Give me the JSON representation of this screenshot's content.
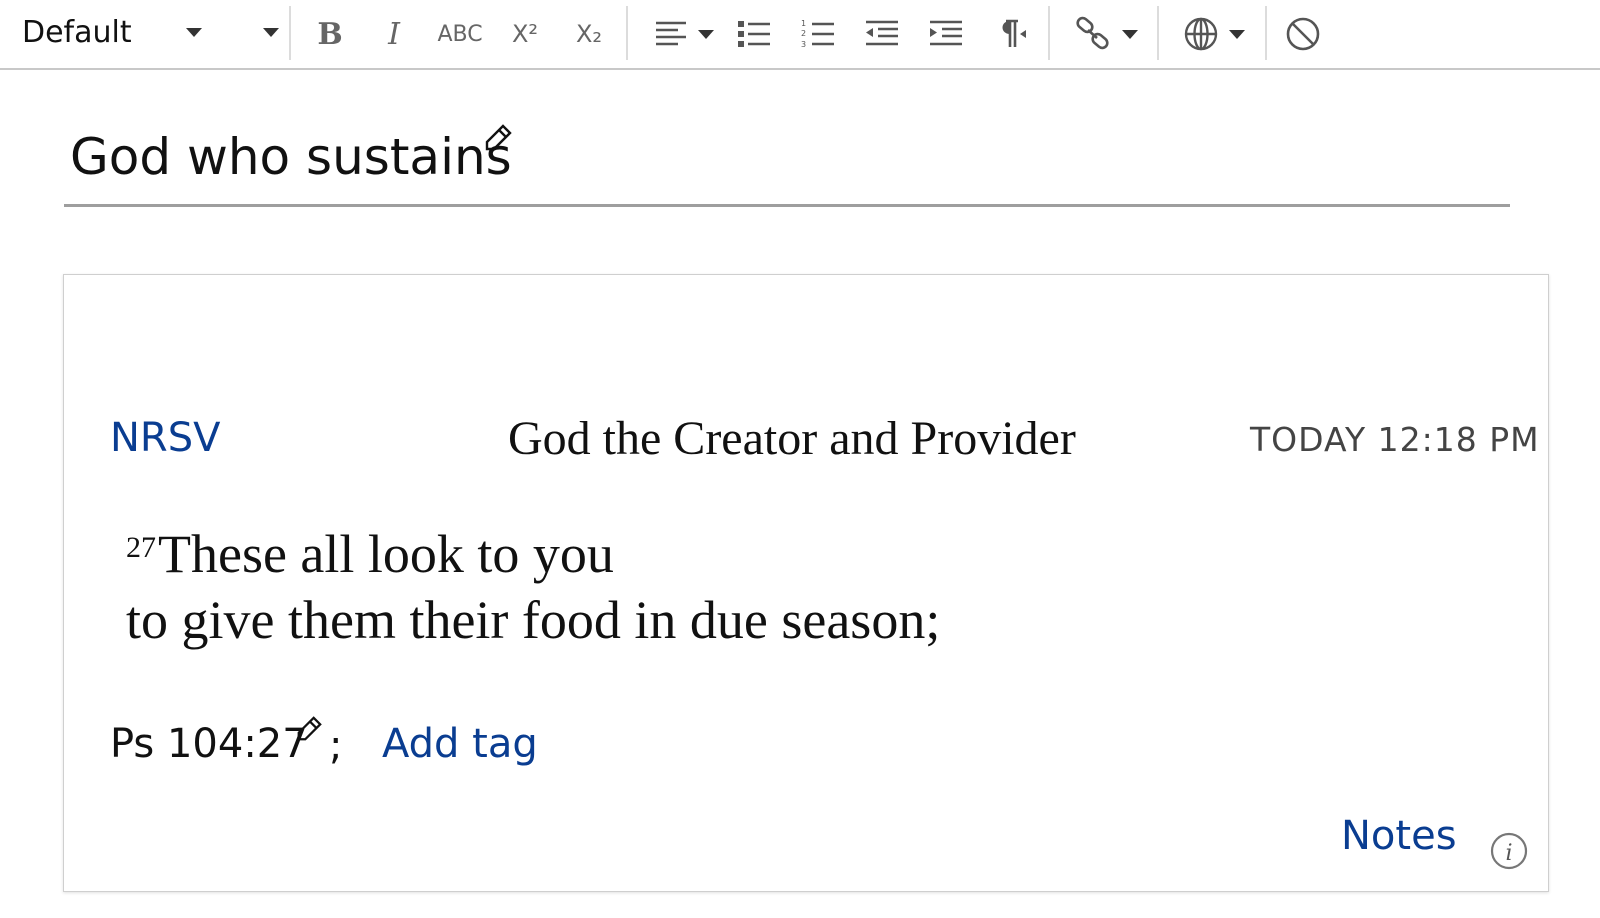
{
  "toolbar": {
    "style_select": {
      "value": "Default"
    },
    "buttons": [
      {
        "name": "bold",
        "label": "B"
      },
      {
        "name": "italic",
        "label": "I"
      },
      {
        "name": "strikethrough",
        "label": "ABC"
      },
      {
        "name": "superscript",
        "label": "X²"
      },
      {
        "name": "subscript",
        "label": "X₂"
      },
      {
        "name": "align-left-icon"
      },
      {
        "name": "bulleted-list-icon"
      },
      {
        "name": "numbered-list-icon"
      },
      {
        "name": "outdent-icon"
      },
      {
        "name": "indent-icon"
      },
      {
        "name": "paragraph-direction-icon"
      },
      {
        "name": "link-icon"
      },
      {
        "name": "globe-icon"
      },
      {
        "name": "clear-format-icon"
      }
    ]
  },
  "note": {
    "title": "God who sustains"
  },
  "card": {
    "version": "NRSV",
    "heading": "God the Creator and Provider",
    "timestamp": "TODAY 12:18 PM",
    "verse_number": "27",
    "verse_line1": "These all look to you",
    "verse_line2": "to give them their food in due season;",
    "reference": "Ps 104:27",
    "separator": ";",
    "add_tag_label": "Add tag",
    "notes_label": "Notes"
  },
  "colors": {
    "link": "#0a3d91",
    "toolbar_icon": "#555555",
    "rule": "#9e9e9e"
  }
}
